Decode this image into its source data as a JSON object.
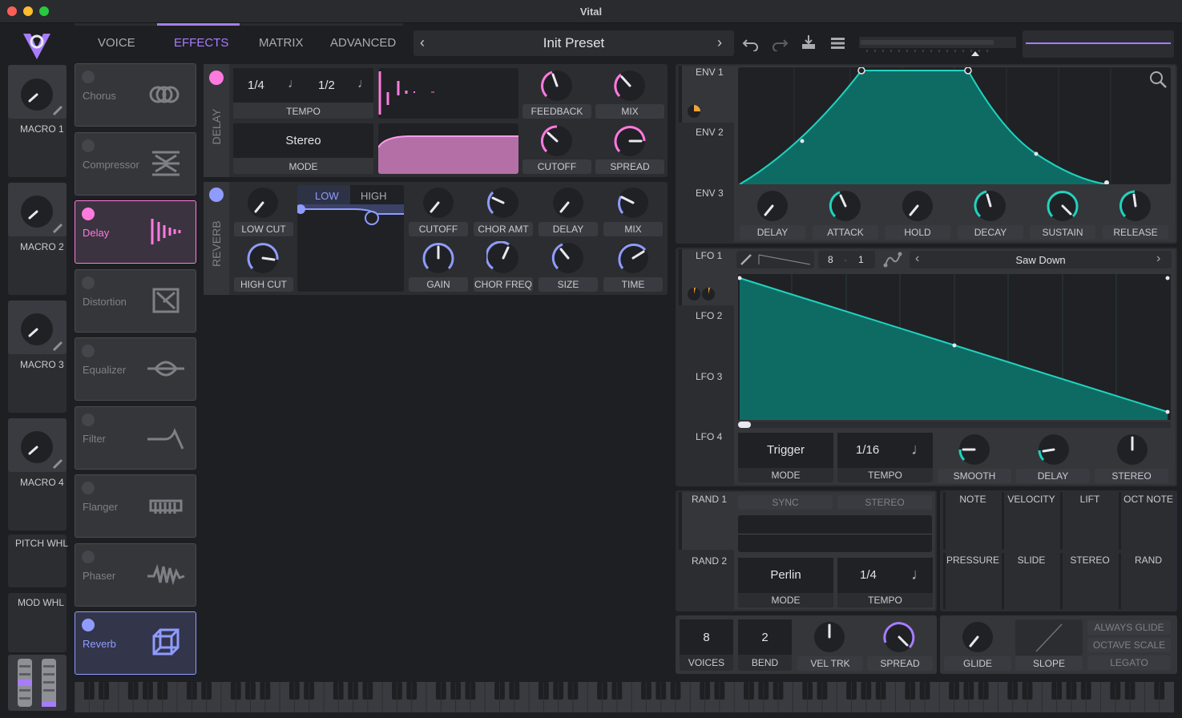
{
  "window": {
    "title": "Vital"
  },
  "colors": {
    "accent": "#a77dff",
    "teal": "#1fd3bf",
    "pink": "#ff7adf",
    "blue": "#8f9cff"
  },
  "tabs": [
    "VOICE",
    "EFFECTS",
    "MATRIX",
    "ADVANCED"
  ],
  "preset": {
    "name": "Init Preset"
  },
  "macros": [
    {
      "label": "MACRO 1"
    },
    {
      "label": "MACRO 2"
    },
    {
      "label": "MACRO 3"
    },
    {
      "label": "MACRO 4"
    }
  ],
  "wheels": {
    "pitch": "PITCH WHL",
    "mod": "MOD WHL"
  },
  "effects_list": [
    "Chorus",
    "Compressor",
    "Delay",
    "Distortion",
    "Equalizer",
    "Filter",
    "Flanger",
    "Phaser",
    "Reverb"
  ],
  "delay": {
    "title": "DELAY",
    "tempo_left": "1/4",
    "tempo_right": "1/2",
    "tempo_label": "TEMPO",
    "mode_value": "Stereo",
    "mode_label": "MODE",
    "feedback": "FEEDBACK",
    "mix": "MIX",
    "cutoff": "CUTOFF",
    "spread": "SPREAD"
  },
  "reverb": {
    "title": "REVERB",
    "low_cut": "LOW CUT",
    "high_cut": "HIGH CUT",
    "low_tab": "LOW",
    "high_tab": "HIGH",
    "cutoff": "CUTOFF",
    "chor_amt": "CHOR AMT",
    "delay": "DELAY",
    "mix": "MIX",
    "gain": "GAIN",
    "chor_freq": "CHOR FREQ",
    "size": "SIZE",
    "time": "TIME"
  },
  "envelopes": {
    "tabs": [
      "ENV 1",
      "ENV 2",
      "ENV 3"
    ],
    "knobs": [
      "DELAY",
      "ATTACK",
      "HOLD",
      "DECAY",
      "SUSTAIN",
      "RELEASE"
    ]
  },
  "lfos": {
    "tabs": [
      "LFO 1",
      "LFO 2",
      "LFO 3",
      "LFO 4"
    ],
    "rate_num": "8",
    "rate_sep": "-",
    "rate_den": "1",
    "shape": "Saw Down",
    "mode_value": "Trigger",
    "mode_label": "MODE",
    "tempo_value": "1/16",
    "tempo_label": "TEMPO",
    "knobs": [
      "SMOOTH",
      "DELAY",
      "STEREO"
    ]
  },
  "random": {
    "tabs": [
      "RAND 1",
      "RAND 2"
    ],
    "sync": "SYNC",
    "stereo": "STEREO",
    "mode_value": "Perlin",
    "mode_label": "MODE",
    "tempo_value": "1/4",
    "tempo_label": "TEMPO"
  },
  "mod_sources": [
    "NOTE",
    "VELOCITY",
    "LIFT",
    "OCT NOTE",
    "PRESSURE",
    "SLIDE",
    "STEREO",
    "RAND"
  ],
  "voice": {
    "voices_value": "8",
    "voices_label": "VOICES",
    "bend_value": "2",
    "bend_label": "BEND",
    "vel_trk": "VEL TRK",
    "spread": "SPREAD"
  },
  "glide": {
    "glide": "GLIDE",
    "slope": "SLOPE",
    "always_glide": "ALWAYS GLIDE",
    "octave_scale": "OCTAVE SCALE",
    "legato": "LEGATO"
  }
}
